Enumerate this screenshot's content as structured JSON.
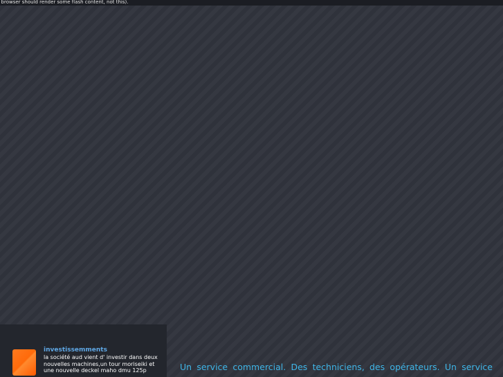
{
  "topbar": {
    "flash_note": "e browser should render some flash content, not this)."
  },
  "news": {
    "icon": "orange-square-icon",
    "title": "investissemments",
    "text": "la société aud vient d' investir dans deux nouvelles machines,un tour moriseiki et une nouvelle deckel maho dmu 125p"
  },
  "intro": {
    "line1": "Un service commercial. Des techniciens, des opérateurs. Un service"
  },
  "colors": {
    "background": "#33363f",
    "accent_blue": "#3fb6e8",
    "title_blue": "#5fa8e6",
    "icon_orange": "#ff6a0a"
  }
}
